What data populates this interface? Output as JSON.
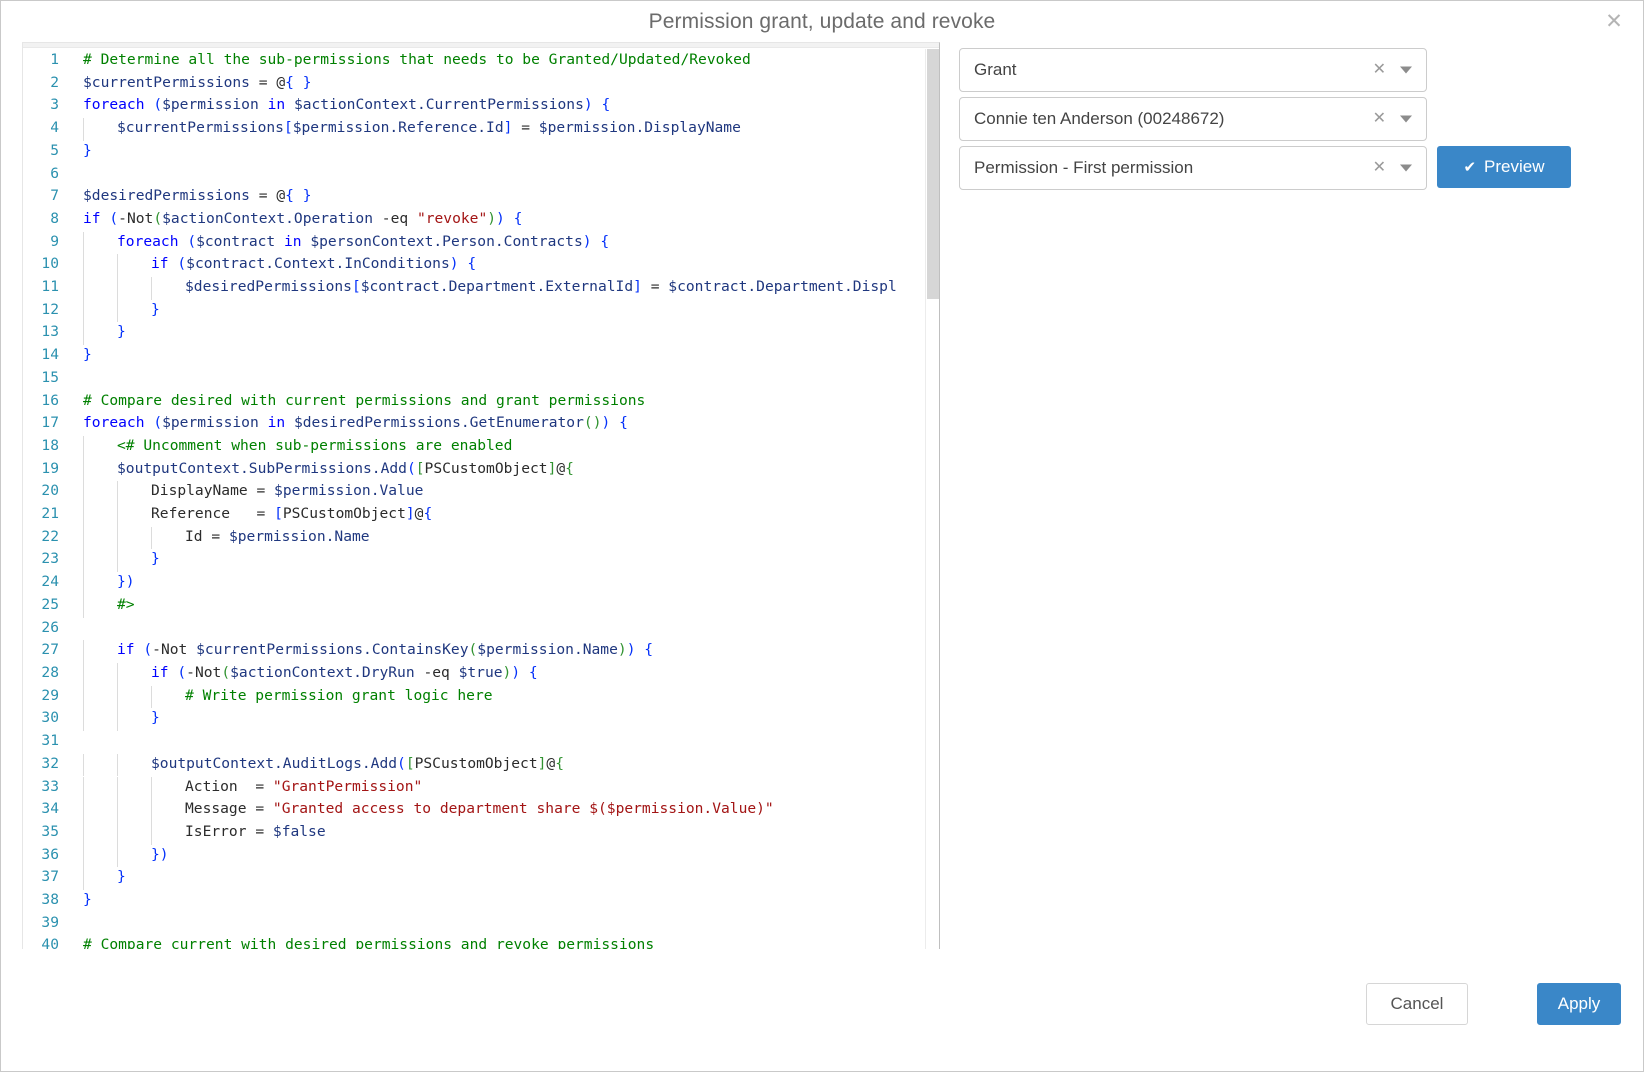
{
  "dialog": {
    "title": "Permission grant, update and revoke",
    "close_label": "✕"
  },
  "form": {
    "fields": [
      {
        "name": "operation",
        "value": "Grant",
        "clear": "✕"
      },
      {
        "name": "person",
        "value": "Connie ten Anderson (00248672)",
        "clear": "✕"
      },
      {
        "name": "permission",
        "value": "Permission - First permission",
        "clear": "✕"
      }
    ],
    "preview_label": "Preview",
    "preview_icon": "✔"
  },
  "footer": {
    "cancel_label": "Cancel",
    "apply_label": "Apply"
  },
  "editor": {
    "language": "powershell",
    "first_visible_line": 1,
    "last_visible_line": 40,
    "colors": {
      "comment": "#008000",
      "keyword": "#0000ff",
      "variable": "#1f377f",
      "string": "#a31515",
      "line_number": "#2b91af",
      "accent": "#3a87c8"
    },
    "lines": [
      {
        "n": 1,
        "indent": 0,
        "text": "# Determine all the sub-permissions that needs to be Granted/Updated/Revoked"
      },
      {
        "n": 2,
        "indent": 0,
        "text": "$currentPermissions = @{ }"
      },
      {
        "n": 3,
        "indent": 0,
        "text": "foreach ($permission in $actionContext.CurrentPermissions) {"
      },
      {
        "n": 4,
        "indent": 1,
        "text": "    $currentPermissions[$permission.Reference.Id] = $permission.DisplayName"
      },
      {
        "n": 5,
        "indent": 0,
        "text": "}"
      },
      {
        "n": 6,
        "indent": 0,
        "text": ""
      },
      {
        "n": 7,
        "indent": 0,
        "text": "$desiredPermissions = @{ }"
      },
      {
        "n": 8,
        "indent": 0,
        "text": "if (-Not($actionContext.Operation -eq \"revoke\")) {"
      },
      {
        "n": 9,
        "indent": 1,
        "text": "    foreach ($contract in $personContext.Person.Contracts) {"
      },
      {
        "n": 10,
        "indent": 2,
        "text": "        if ($contract.Context.InConditions) {"
      },
      {
        "n": 11,
        "indent": 3,
        "text": "            $desiredPermissions[$contract.Department.ExternalId] = $contract.Department.Displ"
      },
      {
        "n": 12,
        "indent": 2,
        "text": "        }"
      },
      {
        "n": 13,
        "indent": 1,
        "text": "    }"
      },
      {
        "n": 14,
        "indent": 0,
        "text": "}"
      },
      {
        "n": 15,
        "indent": 0,
        "text": ""
      },
      {
        "n": 16,
        "indent": 0,
        "text": "# Compare desired with current permissions and grant permissions"
      },
      {
        "n": 17,
        "indent": 0,
        "text": "foreach ($permission in $desiredPermissions.GetEnumerator()) {"
      },
      {
        "n": 18,
        "indent": 1,
        "text": "    <# Uncomment when sub-permissions are enabled"
      },
      {
        "n": 19,
        "indent": 1,
        "text": "    $outputContext.SubPermissions.Add([PSCustomObject]@{"
      },
      {
        "n": 20,
        "indent": 2,
        "text": "        DisplayName = $permission.Value"
      },
      {
        "n": 21,
        "indent": 2,
        "text": "        Reference   = [PSCustomObject]@{"
      },
      {
        "n": 22,
        "indent": 3,
        "text": "            Id = $permission.Name"
      },
      {
        "n": 23,
        "indent": 2,
        "text": "        }"
      },
      {
        "n": 24,
        "indent": 1,
        "text": "    })"
      },
      {
        "n": 25,
        "indent": 1,
        "text": "    #>"
      },
      {
        "n": 26,
        "indent": 0,
        "text": ""
      },
      {
        "n": 27,
        "indent": 1,
        "text": "    if (-Not $currentPermissions.ContainsKey($permission.Name)) {"
      },
      {
        "n": 28,
        "indent": 2,
        "text": "        if (-Not($actionContext.DryRun -eq $true)) {"
      },
      {
        "n": 29,
        "indent": 3,
        "text": "            # Write permission grant logic here"
      },
      {
        "n": 30,
        "indent": 2,
        "text": "        }"
      },
      {
        "n": 31,
        "indent": 0,
        "text": ""
      },
      {
        "n": 32,
        "indent": 2,
        "text": "        $outputContext.AuditLogs.Add([PSCustomObject]@{"
      },
      {
        "n": 33,
        "indent": 3,
        "text": "            Action  = \"GrantPermission\""
      },
      {
        "n": 34,
        "indent": 3,
        "text": "            Message = \"Granted access to department share $($permission.Value)\""
      },
      {
        "n": 35,
        "indent": 3,
        "text": "            IsError = $false"
      },
      {
        "n": 36,
        "indent": 2,
        "text": "        })"
      },
      {
        "n": 37,
        "indent": 1,
        "text": "    }"
      },
      {
        "n": 38,
        "indent": 0,
        "text": "}"
      },
      {
        "n": 39,
        "indent": 0,
        "text": ""
      },
      {
        "n": 40,
        "indent": 0,
        "text": "# Compare current with desired permissions and revoke permissions"
      }
    ]
  }
}
